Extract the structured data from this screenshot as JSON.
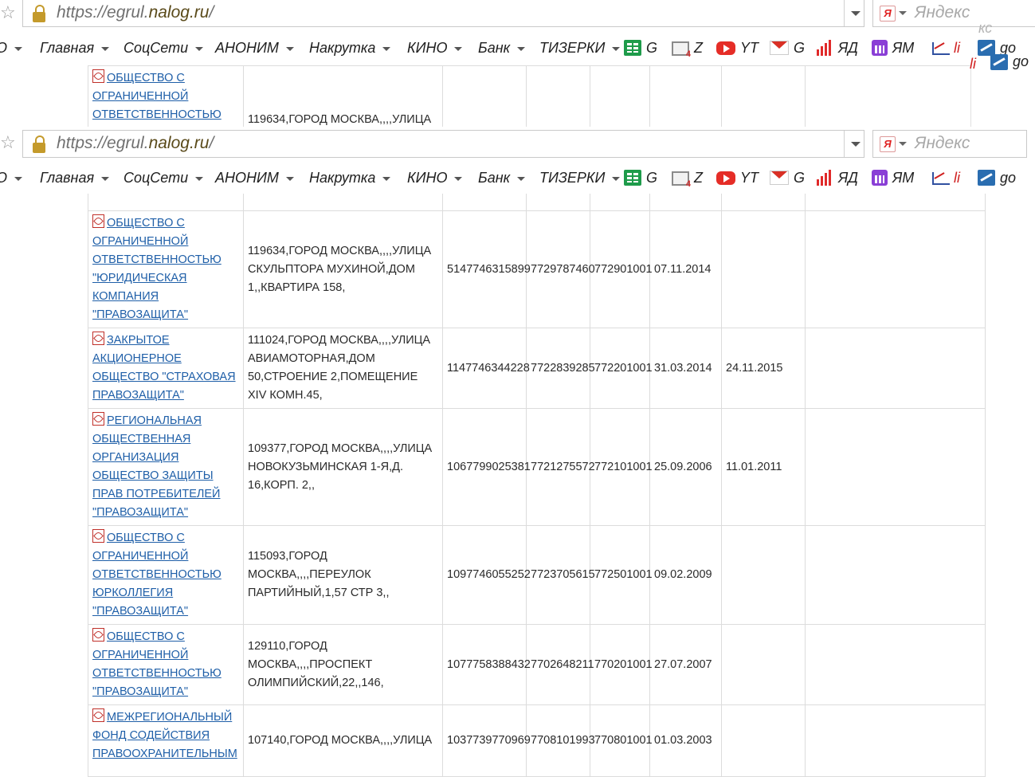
{
  "browser": {
    "url_prefix": "https://egrul.",
    "url_host": "nalog.ru",
    "url_suffix": "/",
    "search_placeholder": "Яндекс",
    "search_logo": "Я",
    "bookmarks": [
      {
        "label": "О",
        "icon": null,
        "dropdown": true
      },
      {
        "label": "Главная",
        "icon": null,
        "dropdown": true
      },
      {
        "label": "СоцСети",
        "icon": null,
        "dropdown": true
      },
      {
        "label": "АНОНИМ",
        "icon": null,
        "dropdown": true
      },
      {
        "label": "Накрутка",
        "icon": null,
        "dropdown": true
      },
      {
        "label": "КИНО",
        "icon": null,
        "dropdown": true
      },
      {
        "label": "Банк",
        "icon": null,
        "dropdown": true
      },
      {
        "label": "ТИЗЕРКИ",
        "icon": null,
        "dropdown": true
      },
      {
        "label": "G",
        "icon": "spreadsheet-icon",
        "dropdown": false
      },
      {
        "label": "Z",
        "icon": "mail-icon",
        "dropdown": false
      },
      {
        "label": "YT",
        "icon": "youtube-icon",
        "dropdown": false
      },
      {
        "label": "G",
        "icon": "gmail-icon",
        "dropdown": false
      },
      {
        "label": "ЯД",
        "icon": "bar-chart-icon",
        "dropdown": false
      },
      {
        "label": "ЯМ",
        "icon": "metrika-icon",
        "dropdown": false
      },
      {
        "label": "li",
        "icon": "trend-chart-icon",
        "dropdown": false
      },
      {
        "label": "go",
        "icon": "analytics-icon",
        "dropdown": false
      }
    ],
    "ghost_search_fragment": "кс",
    "ghost_li": "li",
    "ghost_go": "go"
  },
  "results": {
    "rows": [
      {
        "name": "ОБЩЕСТВО С ОГРАНИЧЕННОЙ ОТВЕТСТВЕННОСТЬЮ \"ЮРИДИЧЕСКАЯ КОМПАНИЯ \"ПРАВОЗАЩИТА\"",
        "address": "119634,ГОРОД МОСКВА,,,,УЛИЦА СКУЛЬПТОРА МУХИНОЙ,ДОМ 1,,КВАРТИРА 158,",
        "ogrn": "5147746315899",
        "inn": "7729787460",
        "kpp": "772901001",
        "reg_date": "07.11.2014",
        "end_date": ""
      },
      {
        "name": "ОБЩЕСТВО С ОГРАНИЧЕННОЙ ОТВЕТСТВЕННОСТЬЮ \"ЮРИДИЧЕСКАЯ КОМПАНИЯ \"ПРАВОЗАЩИТА\"",
        "address": "119634,ГОРОД МОСКВА,,,,УЛИЦА СКУЛЬПТОРА МУХИНОЙ,ДОМ 1,,КВАРТИРА 158,",
        "ogrn": "5147746315899",
        "inn": "7729787460",
        "kpp": "772901001",
        "reg_date": "07.11.2014",
        "end_date": ""
      },
      {
        "name": "ЗАКРЫТОЕ АКЦИОНЕРНОЕ ОБЩЕСТВО \"СТРАХОВАЯ ПРАВОЗАЩИТА\"",
        "address": "111024,ГОРОД МОСКВА,,,,УЛИЦА АВИАМОТОРНАЯ,ДОМ 50,СТРОЕНИЕ 2,ПОМЕЩЕНИЕ XIV КОМН.45,",
        "ogrn": "1147746344228",
        "inn": "7722839285",
        "kpp": "772201001",
        "reg_date": "31.03.2014",
        "end_date": "24.11.2015"
      },
      {
        "name": "РЕГИОНАЛЬНАЯ ОБЩЕСТВЕННАЯ ОРГАНИЗАЦИЯ ОБЩЕСТВО ЗАЩИТЫ ПРАВ ПОТРЕБИТЕЛЕЙ \"ПРАВОЗАЩИТА\"",
        "address": "109377,ГОРОД МОСКВА,,,,УЛИЦА НОВОКУЗЬМИНСКАЯ 1-Я,Д. 16,КОРП. 2,,",
        "ogrn": "1067799025381",
        "inn": "7721275572",
        "kpp": "772101001",
        "reg_date": "25.09.2006",
        "end_date": "11.01.2011"
      },
      {
        "name": "ОБЩЕСТВО С ОГРАНИЧЕННОЙ ОТВЕТСТВЕННОСТЬЮ ЮРКОЛЛЕГИЯ \"ПРАВОЗАЩИТА\"",
        "address": "115093,ГОРОД МОСКВА,,,,ПЕРЕУЛОК ПАРТИЙНЫЙ,1,57 СТР 3,,",
        "ogrn": "1097746055252",
        "inn": "7723705615",
        "kpp": "772501001",
        "reg_date": "09.02.2009",
        "end_date": ""
      },
      {
        "name": "ОБЩЕСТВО С ОГРАНИЧЕННОЙ ОТВЕТСТВЕННОСТЬЮ \"ПРАВОЗАЩИТА\"",
        "address": "129110,ГОРОД МОСКВА,,,,ПРОСПЕКТ ОЛИМПИЙСКИЙ,22,,146,",
        "ogrn": "1077758388432",
        "inn": "7702648211",
        "kpp": "770201001",
        "reg_date": "27.07.2007",
        "end_date": ""
      },
      {
        "name": "МЕЖРЕГИОНАЛЬНЫЙ ФОНД СОДЕЙСТВИЯ ПРАВООХРАНИТЕЛЬНЫМ",
        "address": "107140,ГОРОД МОСКВА,,,,УЛИЦА",
        "ogrn": "1037739770969",
        "inn": "7708101993",
        "kpp": "770801001",
        "reg_date": "01.03.2003",
        "end_date": ""
      }
    ]
  },
  "colors": {
    "link": "#1f5fa8",
    "lock": "#c49a2b",
    "youtube": "#e52d27",
    "sheets": "#1e9b4a"
  }
}
